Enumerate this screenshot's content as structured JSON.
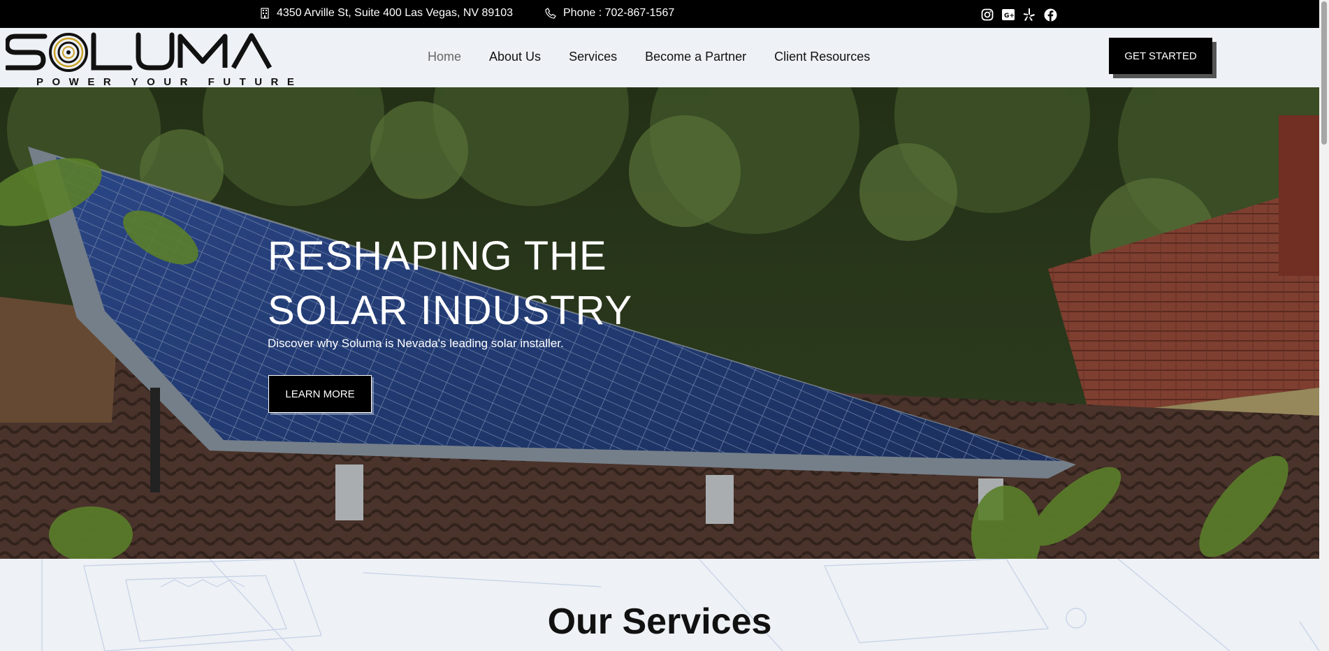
{
  "topbar": {
    "address": "4350 Arville St, Suite 400 Las Vegas, NV 89103",
    "phone": "Phone : 702-867-1567",
    "social_icons": [
      "instagram-icon",
      "google-plus-icon",
      "yelp-icon",
      "facebook-icon"
    ]
  },
  "header": {
    "logo_text": "SOLUMA",
    "logo_tagline": "POWER YOUR FUTURE",
    "nav": [
      {
        "label": "Home",
        "active": true
      },
      {
        "label": "About Us",
        "active": false
      },
      {
        "label": "Services",
        "active": false
      },
      {
        "label": "Become a Partner",
        "active": false
      },
      {
        "label": "Client Resources",
        "active": false
      }
    ],
    "cta_label": "GET STARTED"
  },
  "hero": {
    "title_line1": "RESHAPING THE",
    "title_line2": "SOLAR INDUSTRY",
    "subtitle": "Discover why Soluma is Nevada's leading solar installer.",
    "button_label": "LEARN MORE"
  },
  "services": {
    "title": "Our Services"
  },
  "colors": {
    "topbar_bg": "#000000",
    "header_bg": "#eef1f5",
    "button_bg": "#000000",
    "panel_blue": "#1f3f86",
    "logo_gold": "#c9a227"
  }
}
